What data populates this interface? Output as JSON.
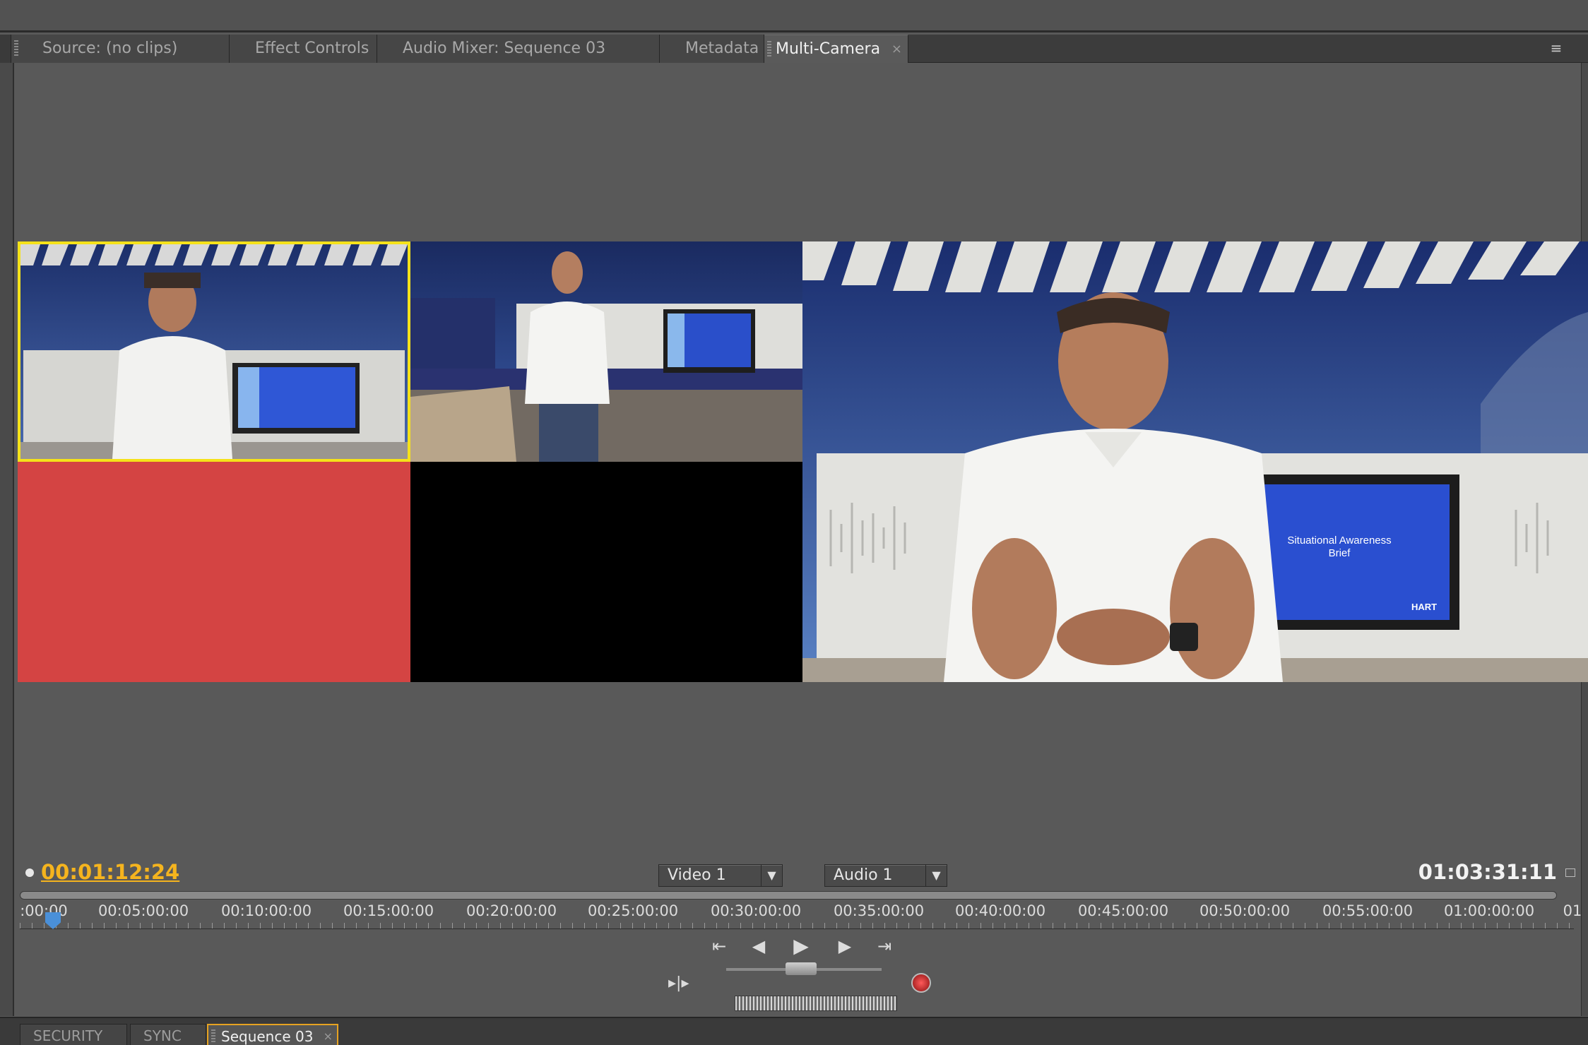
{
  "tabs": [
    {
      "label": "Source: (no clips)"
    },
    {
      "label": "Effect Controls"
    },
    {
      "label": "Audio Mixer: Sequence 03"
    },
    {
      "label": "Metadata"
    },
    {
      "label": "Multi-Camera"
    }
  ],
  "icons": {
    "close": "×",
    "panel_menu": "≡",
    "dropdown_arrow": "▼",
    "step_back_edit": "⇤",
    "step_back": "◀",
    "play": "▶",
    "step_forward": "▶",
    "step_forward_edit": "⇥",
    "multicam_toggle": "▸|▸"
  },
  "program": {
    "screen_line1": "Situational Awareness",
    "screen_line2": "Brief",
    "logo": "HART"
  },
  "timecode": {
    "current": "00:01:12:24",
    "duration": "01:03:31:11"
  },
  "selectors": {
    "video": "Video 1",
    "audio": "Audio 1"
  },
  "ruler": {
    "ticks": [
      ":00:00",
      "00:05:00:00",
      "00:10:00:00",
      "00:15:00:00",
      "00:20:00:00",
      "00:25:00:00",
      "00:30:00:00",
      "00:35:00:00",
      "00:40:00:00",
      "00:45:00:00",
      "00:50:00:00",
      "00:55:00:00",
      "01:00:00:00",
      "01"
    ]
  },
  "bottom_tabs": [
    {
      "label": "SECURITY"
    },
    {
      "label": "SYNC"
    },
    {
      "label": "Sequence 03"
    }
  ],
  "colors": {
    "active_camera": "#f5e21a",
    "timecode": "#f5b41e",
    "camera3_bg": "#d44443",
    "active_tab_outline": "#e6a221"
  }
}
